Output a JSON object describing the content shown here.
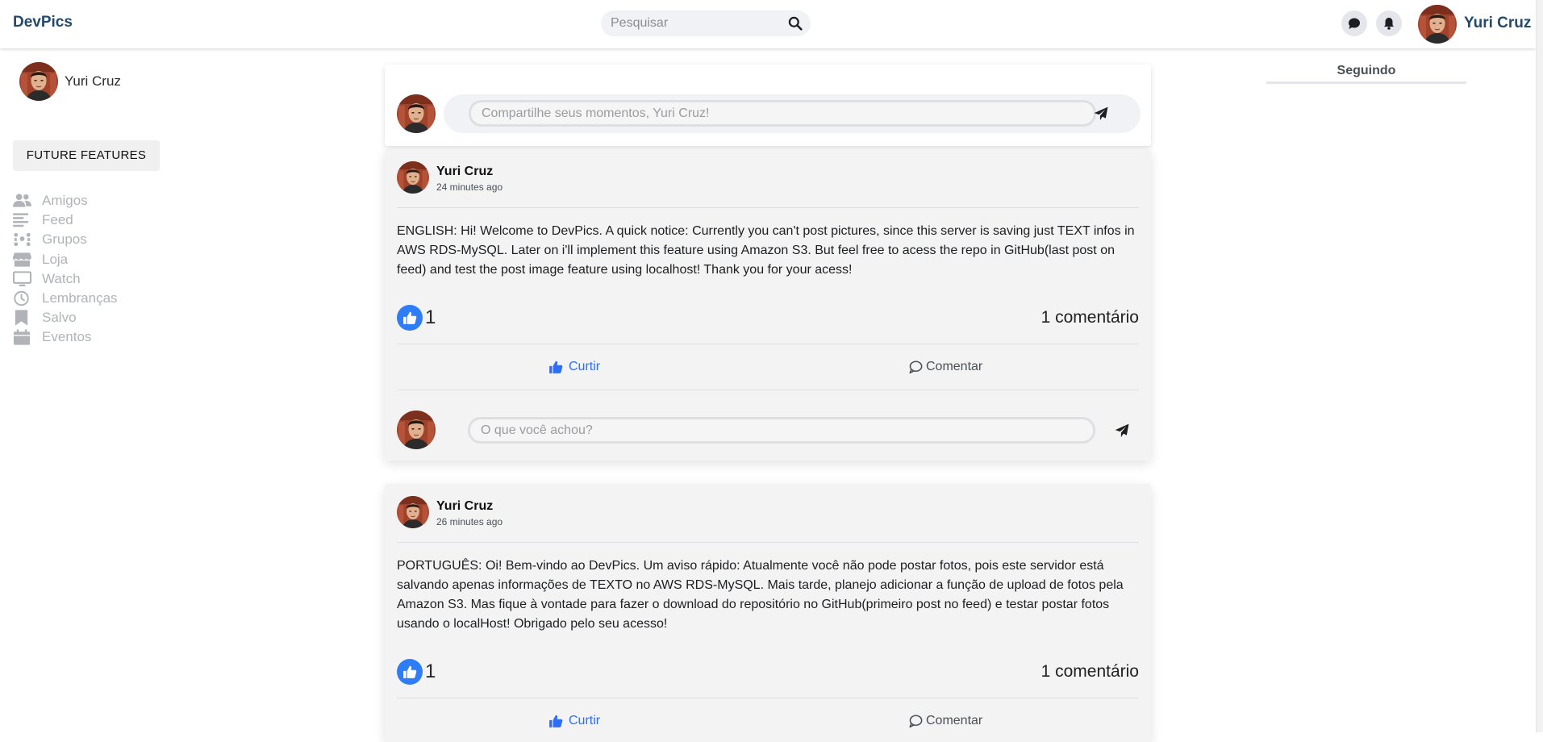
{
  "navbar": {
    "brand": "DevPics",
    "search_placeholder": "Pesquisar",
    "username": "Yuri Cruz",
    "icons": [
      "search-icon",
      "chat-icon",
      "bell-icon"
    ]
  },
  "sidebar": {
    "username": "Yuri Cruz",
    "future_features_label": "FUTURE FEATURES",
    "items": [
      {
        "label": "Amigos",
        "icon": "friends-icon"
      },
      {
        "label": "Feed",
        "icon": "feed-icon"
      },
      {
        "label": "Grupos",
        "icon": "groups-icon"
      },
      {
        "label": "Loja",
        "icon": "store-icon"
      },
      {
        "label": "Watch",
        "icon": "tv-icon"
      },
      {
        "label": "Lembranças",
        "icon": "clock-icon"
      },
      {
        "label": "Salvo",
        "icon": "bookmark-icon"
      },
      {
        "label": "Eventos",
        "icon": "calendar-icon"
      }
    ]
  },
  "right": {
    "following_title": "Seguindo"
  },
  "composer": {
    "placeholder": "Compartilhe seus momentos, Yuri Cruz!"
  },
  "posts": [
    {
      "author": "Yuri Cruz",
      "time": "24 minutes ago",
      "text": "ENGLISH: Hi! Welcome to DevPics. A quick notice: Currently you can't post pictures, since this server is saving just TEXT infos in AWS RDS-MySQL. Later on i'll implement this feature using Amazon S3. But feel free to acess the repo in GitHub(last post on feed) and test the post image feature using localhost! Thank you for your acess!",
      "likes": "1",
      "comments": "1 comentário",
      "like_label": "Curtir",
      "comment_label": "Comentar",
      "reply_placeholder": "O que você achou?"
    },
    {
      "author": "Yuri Cruz",
      "time": "26 minutes ago",
      "text": "PORTUGUÊS: Oi! Bem-vindo ao DevPics. Um aviso rápido: Atualmente você não pode postar fotos, pois este servidor está salvando apenas informações de TEXTO no AWS RDS-MySQL. Mais tarde, planejo adicionar a função de upload de fotos pela Amazon S3. Mas fique à vontade para fazer o download do repositório no GitHub(primeiro post no feed) e testar postar fotos usando o localHost! Obrigado pelo seu acesso!",
      "likes": "1",
      "comments": "1 comentário",
      "like_label": "Curtir",
      "comment_label": "Comentar"
    }
  ],
  "colors": {
    "brand": "#234a6b",
    "like_blue": "#2f7df6",
    "menu_gray": "#b0b3b8",
    "post_bg": "#f3f3f3"
  }
}
